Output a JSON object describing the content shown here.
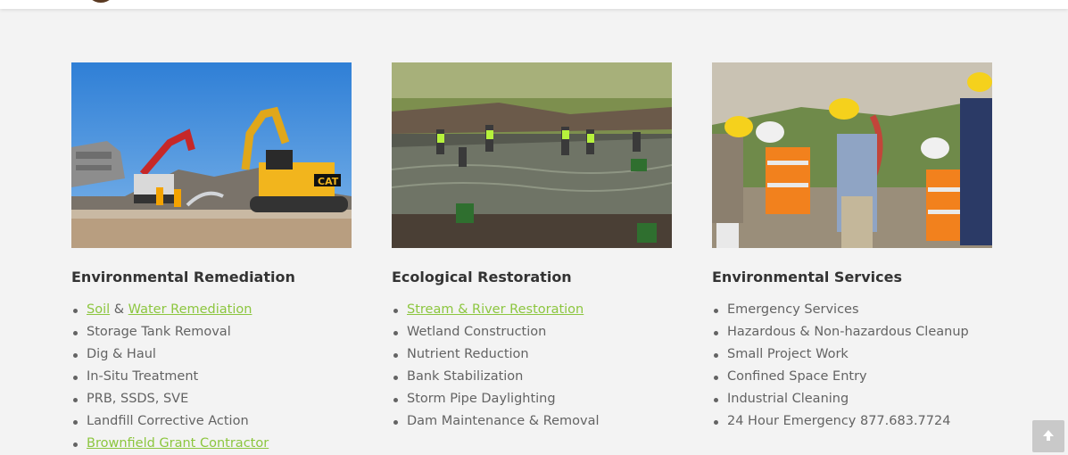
{
  "header": {
    "logo_icon": "logo-icon"
  },
  "columns": [
    {
      "photo_icon": "demolition-excavators-photo",
      "heading": "Environmental Remediation",
      "items": [
        {
          "parts": [
            "Soil",
            " & ",
            "Water Remediation"
          ]
        },
        {
          "text": "Storage Tank Removal"
        },
        {
          "text": "Dig & Haul"
        },
        {
          "text": "In-Situ Treatment"
        },
        {
          "text": "PRB, SSDS, SVE"
        },
        {
          "text": "Landfill Corrective Action"
        },
        {
          "text": "Brownfield Grant Contractor"
        }
      ]
    },
    {
      "photo_icon": "wetland-planting-photo",
      "heading": "Ecological Restoration",
      "items": [
        {
          "text": "Stream & River Restoration"
        },
        {
          "text": "Wetland Construction"
        },
        {
          "text": "Nutrient Reduction"
        },
        {
          "text": "Bank Stabilization"
        },
        {
          "text": "Storm Pipe Daylighting"
        },
        {
          "text": "Dam Maintenance & Removal"
        }
      ]
    },
    {
      "photo_icon": "field-workers-hardhats-photo",
      "heading": "Environmental Services",
      "items": [
        {
          "text": "Emergency Services"
        },
        {
          "text": "Hazardous & Non-hazardous Cleanup"
        },
        {
          "text": "Small Project Work"
        },
        {
          "text": "Confined Space Entry"
        },
        {
          "text": "Industrial Cleaning"
        },
        {
          "text": "24 Hour Emergency 877.683.7724"
        }
      ]
    }
  ],
  "scroll_top": {
    "icon": "arrow-up-icon"
  },
  "colors": {
    "background": "#f3f3f3",
    "heading": "#333333",
    "text": "#636363",
    "link": "#8cc63f",
    "scroll_button": "#c9c9c9"
  }
}
